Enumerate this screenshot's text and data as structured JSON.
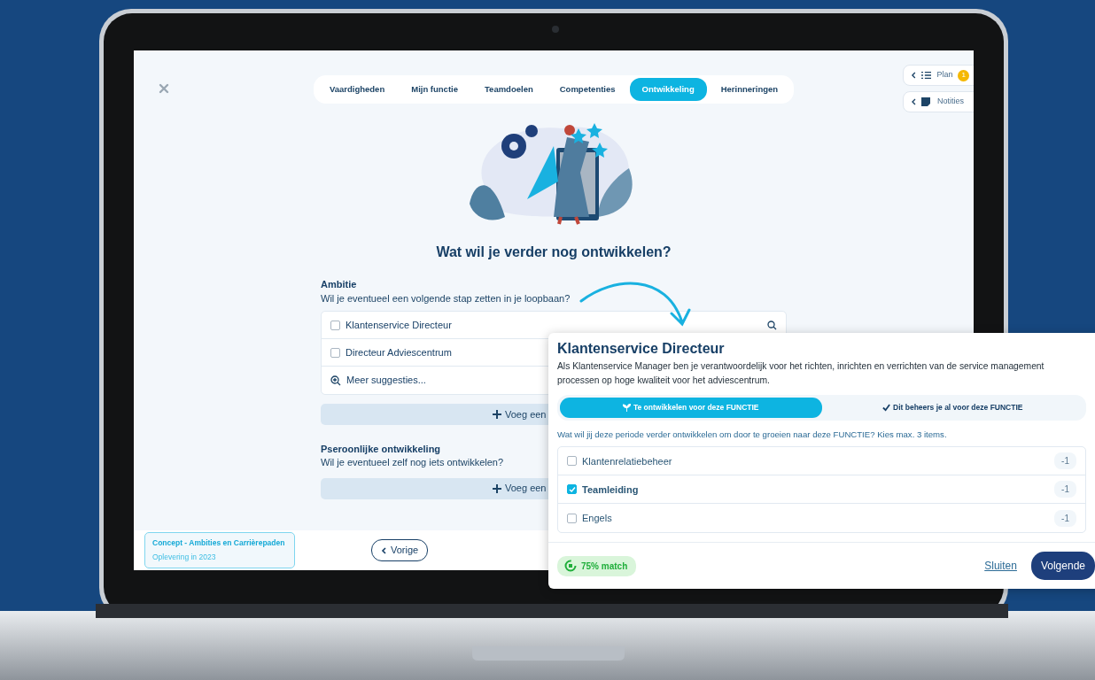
{
  "tabs": [
    {
      "label": "Vaardigheden",
      "selected": false
    },
    {
      "label": "Mijn functie",
      "selected": false
    },
    {
      "label": "Teamdoelen",
      "selected": false
    },
    {
      "label": "Competenties",
      "selected": false
    },
    {
      "label": "Ontwikkeling",
      "selected": true
    },
    {
      "label": "Herinneringen",
      "selected": false
    }
  ],
  "side_buttons": [
    {
      "kind": "list",
      "label": "Plan",
      "badge": "1"
    },
    {
      "kind": "note",
      "label": "Notities"
    }
  ],
  "heading": "Wat wil je verder nog ontwikkelen?",
  "sections": [
    {
      "title": "Ambitie",
      "subtitle": "Wil je eventueel een volgende stap zetten in je loopbaan?",
      "options": [
        {
          "label": "Klantenservice Directeur",
          "checked": false
        },
        {
          "label": "Directeur Adviescentrum",
          "checked": false
        }
      ],
      "suggestions_link": "Meer suggesties...",
      "add_button": "Voeg een"
    },
    {
      "title": "Pseroonlijke ontwikkeling",
      "subtitle": "Wil je eventueel zelf nog iets ontwikkelen?",
      "add_button": "Voeg een"
    }
  ],
  "footer": {
    "concept_title": "Concept - Ambities en Carrièrepaden",
    "concept_subtitle": "Oplevering in 2023",
    "prev_button": "Vorige"
  },
  "popup": {
    "title": "Klantenservice Directeur",
    "description": "Als Klantenservice Manager ben je verantwoordelijk voor het richten, inrichten en verrichten van de service management processen op hoge kwaliteit voor het adviescentrum.",
    "toggle": [
      {
        "kind": "sprout",
        "label": "Te ontwikkelen voor deze FUNCTIE",
        "selected": true
      },
      {
        "kind": "check",
        "label": "Dit beheers je al voor deze FUNCTIE",
        "selected": false
      }
    ],
    "question": "Wat wil jij deze periode verder ontwikkelen om door te groeien naar deze FUNCTIE? Kies max. 3 items.",
    "items": [
      {
        "label": "Klantenrelatiebeheer",
        "checked": false,
        "badge": "-1"
      },
      {
        "label": "Teamleiding",
        "checked": true,
        "badge": "-1"
      },
      {
        "label": "Engels",
        "checked": false,
        "badge": "-1"
      }
    ],
    "match": "75% match",
    "close_link": "Sluiten",
    "next_button": "Volgende"
  }
}
